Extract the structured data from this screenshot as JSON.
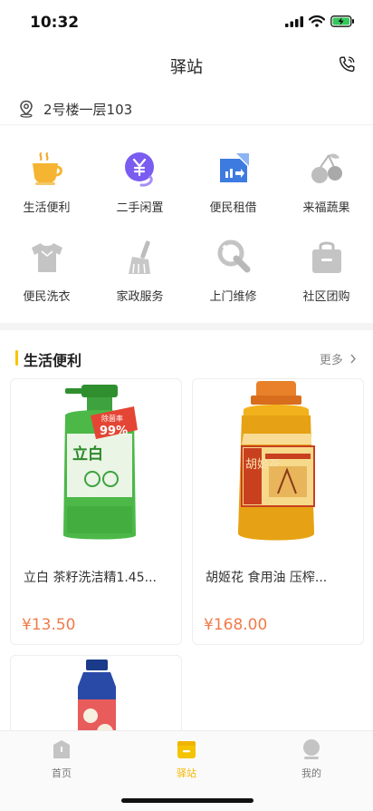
{
  "status_bar": {
    "time": "10:32"
  },
  "header": {
    "title": "驿站"
  },
  "address": {
    "text": "2号楼一层103"
  },
  "services": [
    {
      "label": "生活便利",
      "icon": "coffee-cup-icon"
    },
    {
      "label": "二手闲置",
      "icon": "yen-exchange-icon"
    },
    {
      "label": "便民租借",
      "icon": "rental-arrow-icon"
    },
    {
      "label": "来福蔬果",
      "icon": "cherry-icon"
    },
    {
      "label": "便民洗衣",
      "icon": "tshirt-icon"
    },
    {
      "label": "家政服务",
      "icon": "broom-icon"
    },
    {
      "label": "上门维修",
      "icon": "wrench-icon"
    },
    {
      "label": "社区团购",
      "icon": "shopping-bag-icon"
    }
  ],
  "section": {
    "title": "生活便利",
    "more": "更多"
  },
  "products": [
    {
      "name": "立白 茶籽洗洁精1.45...",
      "price": "¥13.50",
      "badge_text": "除菌率",
      "badge_value": "99%",
      "brand": "立白"
    },
    {
      "name": "胡姬花 食用油 压榨...",
      "price": "¥168.00",
      "brand": "胡姬花"
    },
    {
      "name": "",
      "price": ""
    }
  ],
  "tabbar": [
    {
      "label": "首页",
      "active": false
    },
    {
      "label": "驿站",
      "active": true
    },
    {
      "label": "我的",
      "active": false
    }
  ],
  "colors": {
    "accent": "#f5c400",
    "price": "#f07b4a",
    "icon_gray": "#c8c8c8"
  }
}
